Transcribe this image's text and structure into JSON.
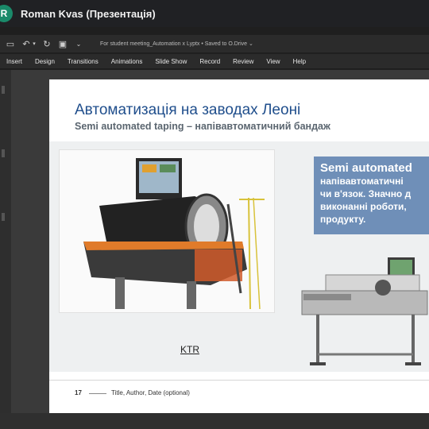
{
  "meeting": {
    "avatar_letter": "R",
    "title": "Roman Kvas (Презентація)"
  },
  "ppt": {
    "doc_title": "For student meeting_Automation x Lyptx • Saved to O.Drive ⌄",
    "tabs": [
      "Insert",
      "Design",
      "Transitions",
      "Animations",
      "Slide Show",
      "Record",
      "Review",
      "View",
      "Help"
    ]
  },
  "slide": {
    "title": "Автоматизація на заводах Леоні",
    "subtitle": "Semi automated taping – напівавтоматичний бандаж",
    "callout": {
      "heading": "Semi automated",
      "lines": [
        "напівавтоматичні",
        "чи в'язок. Значно д",
        "виконанні роботи,",
        "продукту."
      ]
    },
    "image_caption": "KTR",
    "footer": {
      "number": "17",
      "text": "Title, Author, Date (optional)"
    }
  },
  "colors": {
    "title_blue": "#1f4e8c",
    "callout_bg": "#6f8fb8",
    "avatar_green": "#1a8a6a"
  }
}
